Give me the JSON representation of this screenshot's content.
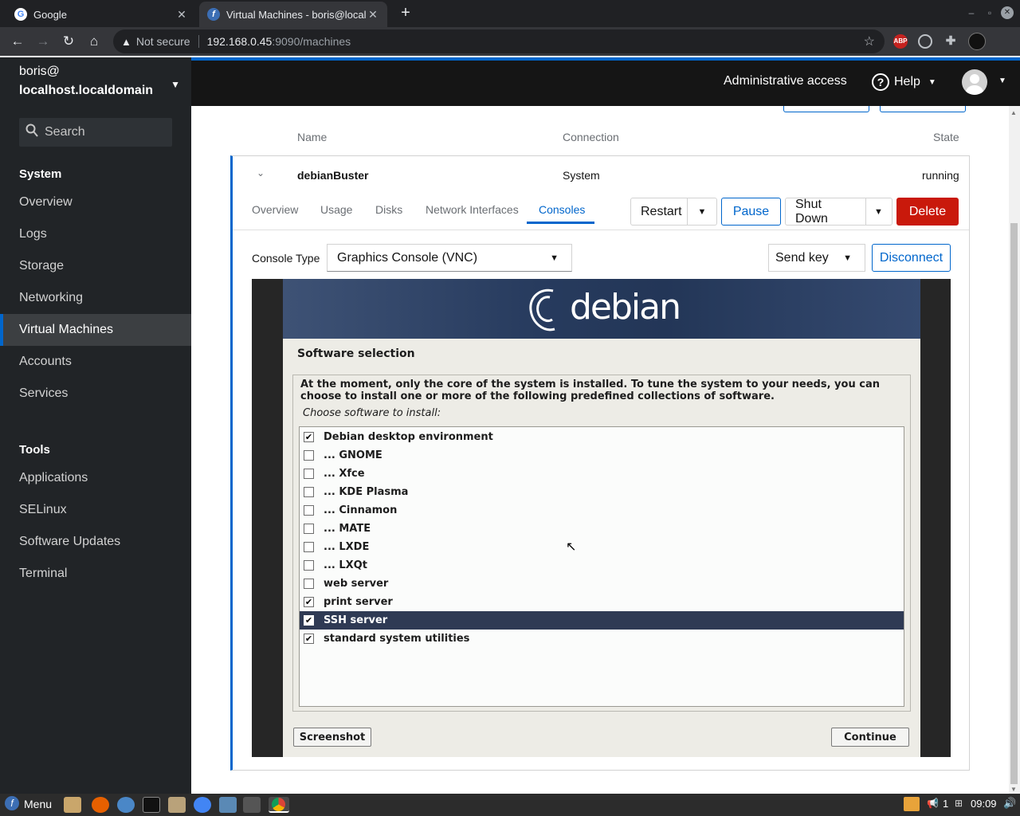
{
  "browser": {
    "tabs": [
      {
        "title": "Google",
        "active": false
      },
      {
        "title": "Virtual Machines - boris@localh",
        "active": true
      }
    ],
    "new_tab": "+",
    "url_warning": "Not secure",
    "url_host": "192.168.0.45",
    "url_path": ":9090/machines",
    "extensions": [
      "adblock-icon",
      "globe-icon",
      "puzzle-icon",
      "profile-icon"
    ]
  },
  "sidebar": {
    "host_user": "boris@",
    "host_name": "localhost.localdomain",
    "search_placeholder": "Search",
    "system_header": "System",
    "system_items": [
      "Overview",
      "Logs",
      "Storage",
      "Networking",
      "Virtual Machines",
      "Accounts",
      "Services"
    ],
    "active_item": "Virtual Machines",
    "tools_header": "Tools",
    "tools_items": [
      "Applications",
      "SELinux",
      "Software Updates",
      "Terminal"
    ]
  },
  "masthead": {
    "admin": "Administrative access",
    "help": "Help"
  },
  "table": {
    "col_name": "Name",
    "col_connection": "Connection",
    "col_state": "State"
  },
  "vm": {
    "name": "debianBuster",
    "connection": "System",
    "state": "running",
    "tabs": [
      "Overview",
      "Usage",
      "Disks",
      "Network Interfaces",
      "Consoles"
    ],
    "active_tab": "Consoles",
    "restart": "Restart",
    "pause": "Pause",
    "shutdown": "Shut Down",
    "delete": "Delete",
    "console_type_label": "Console Type",
    "console_type_value": "Graphics Console (VNC)",
    "send_key": "Send key",
    "disconnect": "Disconnect"
  },
  "installer": {
    "logo_text": "debian",
    "title": "Software selection",
    "intro": "At the moment, only the core of the system is installed. To tune the system to your needs, you can choose to install one or more of the following predefined collections of software.",
    "choose": "Choose software to install:",
    "items": [
      {
        "label": "Debian desktop environment",
        "checked": true,
        "selected": false
      },
      {
        "label": "... GNOME",
        "checked": false,
        "selected": false
      },
      {
        "label": "... Xfce",
        "checked": false,
        "selected": false
      },
      {
        "label": "... KDE Plasma",
        "checked": false,
        "selected": false
      },
      {
        "label": "... Cinnamon",
        "checked": false,
        "selected": false
      },
      {
        "label": "... MATE",
        "checked": false,
        "selected": false
      },
      {
        "label": "... LXDE",
        "checked": false,
        "selected": false
      },
      {
        "label": "... LXQt",
        "checked": false,
        "selected": false
      },
      {
        "label": "web server",
        "checked": false,
        "selected": false
      },
      {
        "label": "print server",
        "checked": true,
        "selected": false
      },
      {
        "label": "SSH server",
        "checked": true,
        "selected": true
      },
      {
        "label": "standard system utilities",
        "checked": true,
        "selected": false
      }
    ],
    "screenshot": "Screenshot",
    "continue": "Continue"
  },
  "taskbar": {
    "menu": "Menu",
    "workspace": "1",
    "clock": "09:09"
  },
  "colors": {
    "accent": "#0066cc",
    "danger": "#c9190b",
    "sidebar_bg": "#212427",
    "selected_row": "#2f3a54"
  }
}
